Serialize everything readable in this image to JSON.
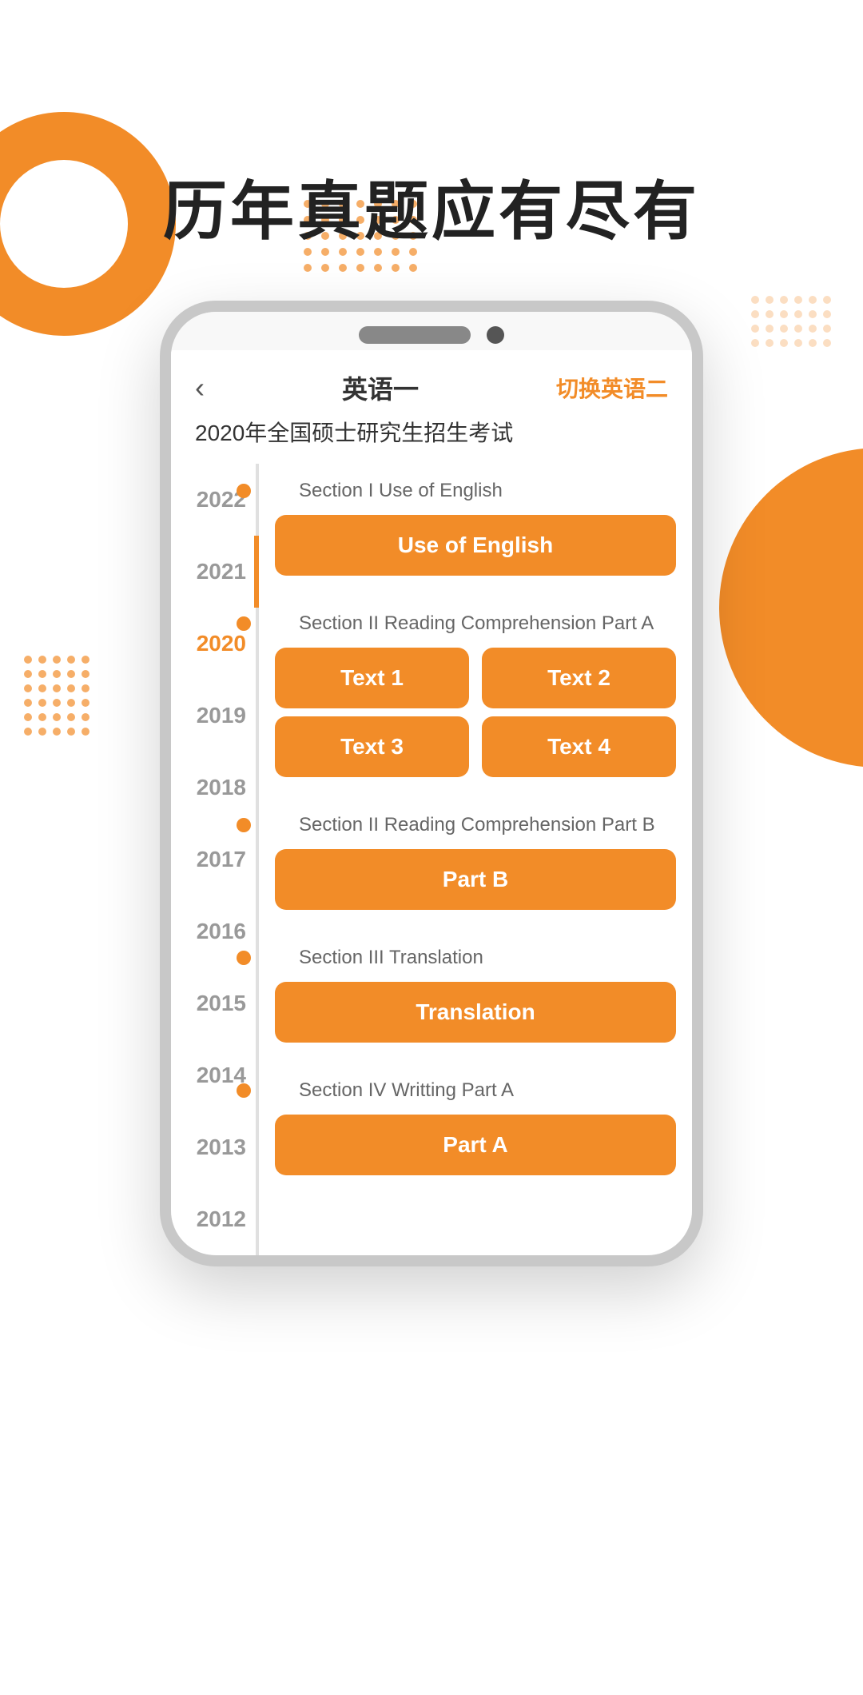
{
  "page": {
    "hero_title": "历年真题应有尽有",
    "accent_color": "#F28C28"
  },
  "screen_header": {
    "back_icon": "‹",
    "title": "英语一",
    "switch_label": "切换英语二"
  },
  "exam": {
    "name": "2020年全国硕士研究生招生考试"
  },
  "timeline": {
    "years": [
      {
        "year": "2022",
        "active": false
      },
      {
        "year": "2021",
        "active": false
      },
      {
        "year": "2020",
        "active": true
      },
      {
        "year": "2019",
        "active": false
      },
      {
        "year": "2018",
        "active": false
      },
      {
        "year": "2017",
        "active": false
      },
      {
        "year": "2016",
        "active": false
      },
      {
        "year": "2015",
        "active": false
      },
      {
        "year": "2014",
        "active": false
      },
      {
        "year": "2013",
        "active": false
      },
      {
        "year": "2012",
        "active": false
      }
    ]
  },
  "sections": [
    {
      "id": "section1",
      "label": "Section I Use of English",
      "buttons": [
        {
          "label": "Use of English",
          "cols": 1
        }
      ]
    },
    {
      "id": "section2",
      "label": "Section II Reading Comprehension Part A",
      "buttons": [
        {
          "label": "Text 1",
          "cols": 2
        },
        {
          "label": "Text 2",
          "cols": 2
        },
        {
          "label": "Text 3",
          "cols": 2
        },
        {
          "label": "Text 4",
          "cols": 2
        }
      ]
    },
    {
      "id": "section3",
      "label": "Section II Reading Comprehension Part B",
      "buttons": [
        {
          "label": "Part B",
          "cols": 1
        }
      ]
    },
    {
      "id": "section4",
      "label": "Section III Translation",
      "buttons": [
        {
          "label": "Translation",
          "cols": 1
        }
      ]
    },
    {
      "id": "section5",
      "label": "Section IV Writting Part A",
      "buttons": [
        {
          "label": "Part A",
          "cols": 1
        }
      ]
    }
  ]
}
